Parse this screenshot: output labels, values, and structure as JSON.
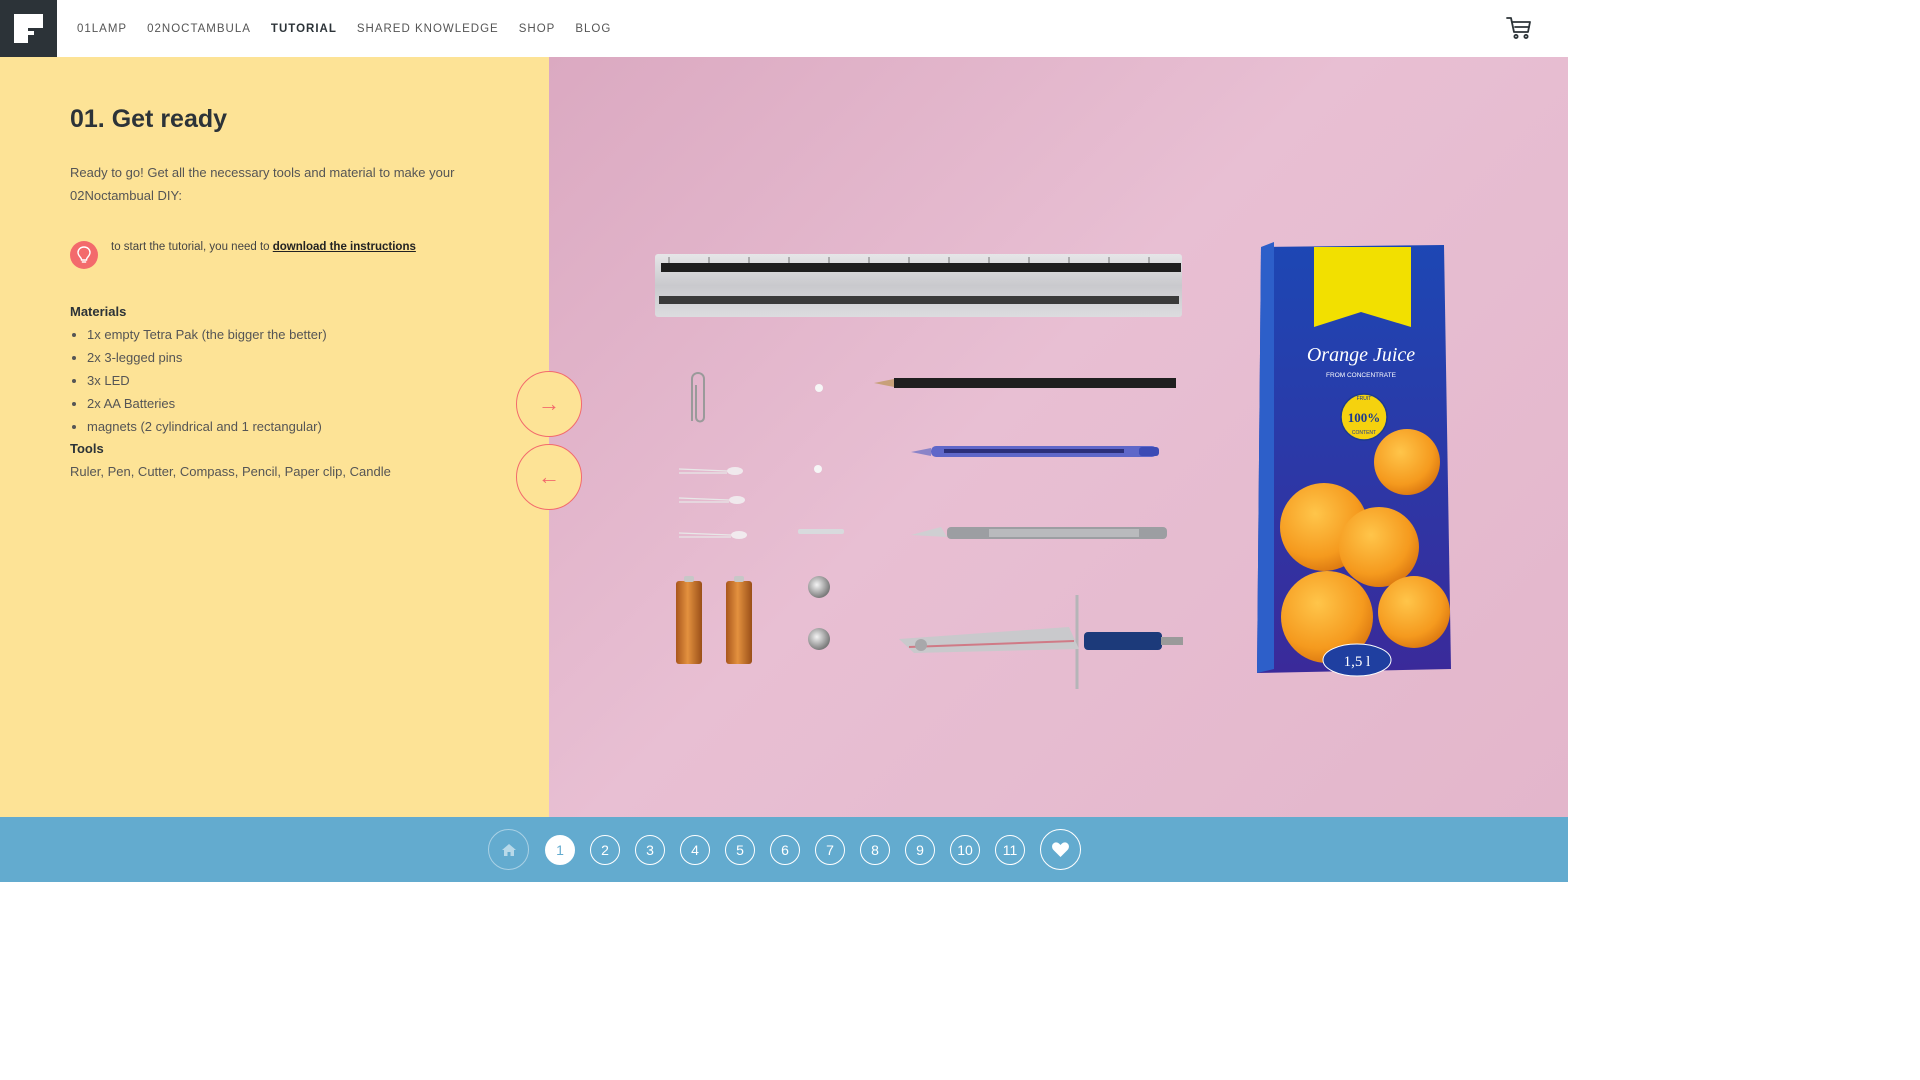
{
  "nav": {
    "items": [
      {
        "label": "01LAMP",
        "active": false
      },
      {
        "label": "02NOCTAMBULA",
        "active": false
      },
      {
        "label": "TUTORIAL",
        "active": true
      },
      {
        "label": "SHARED KNOWLEDGE",
        "active": false
      },
      {
        "label": "SHOP",
        "active": false
      },
      {
        "label": "BLOG",
        "active": false
      }
    ]
  },
  "content": {
    "title": "01. Get ready",
    "intro": "Ready to go! Get all the necessary tools and material to make your 02Noctambual DIY:",
    "tip_prefix": "to start the tutorial, you need to ",
    "tip_link": "download the instructions",
    "materials_heading": "Materials",
    "materials": [
      "1x empty Tetra Pak (the bigger the better)",
      "2x 3-legged pins",
      "3x LED",
      "2x AA Batteries",
      "magnets (2 cylindrical and 1 rectangular)"
    ],
    "tools_heading": "Tools",
    "tools": "Ruler, Pen, Cutter, Compass, Pencil, Paper clip, Candle"
  },
  "arrows": {
    "next": "→",
    "prev": "←"
  },
  "photo": {
    "juice_title": "Orange Juice",
    "juice_sub": "FROM CONCENTRATE",
    "juice_badge": "100%",
    "juice_badge_top": "FRUIT",
    "juice_badge_bottom": "CONTENT",
    "juice_volume": "1,5 l"
  },
  "pager": {
    "steps": [
      "1",
      "2",
      "3",
      "4",
      "5",
      "6",
      "7",
      "8",
      "9",
      "10",
      "11"
    ],
    "active": "1"
  },
  "colors": {
    "left_bg": "#fde396",
    "accent": "#f36a6c",
    "bottom_bg": "#63abcf",
    "photo_bg": "#e3b6cb",
    "dark": "#2c3338"
  },
  "icons": {
    "logo": "brand-logo-icon",
    "cart": "cart-icon",
    "tip": "lightbulb-icon",
    "home": "home-icon",
    "fav": "heart-icon"
  }
}
